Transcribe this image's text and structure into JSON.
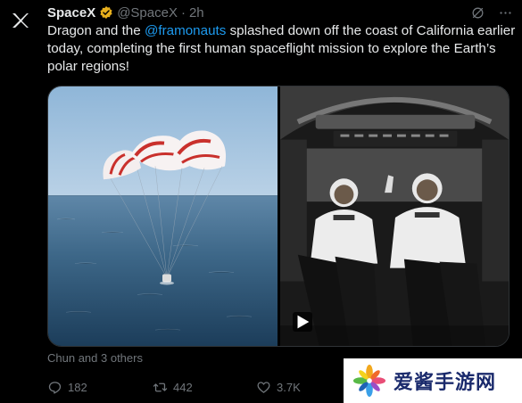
{
  "tweet": {
    "author_name": "SpaceX",
    "handle": "@SpaceX",
    "separator": "·",
    "time": "2h",
    "text_part1": "Dragon and the ",
    "mention": "@framonauts",
    "text_part2": " splashed down off the coast of California earlier today, completing the first human spaceflight mission to explore the Earth’s polar regions!"
  },
  "social_context": {
    "liked_by": "Chun and 3 others"
  },
  "actions": {
    "replies": "182",
    "reposts": "442",
    "likes": "3.7K"
  },
  "media": {
    "left_image": "dragon-splashdown-parachutes",
    "right_image": "astronauts-in-capsule",
    "has_video": true
  },
  "watermark": {
    "text": "爱酱手游网"
  },
  "colors": {
    "background": "#000000",
    "text": "#e7e9ea",
    "muted": "#71767b",
    "link": "#1d9bf0",
    "verified_gold": "#e8b01d"
  }
}
